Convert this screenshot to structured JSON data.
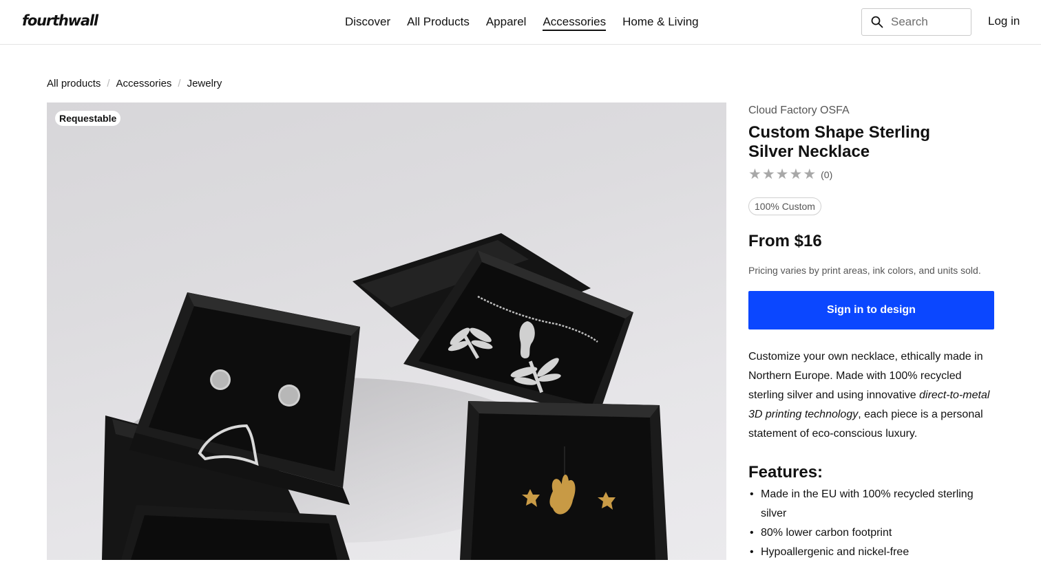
{
  "header": {
    "logo": "fourthwall",
    "nav": [
      "Discover",
      "All Products",
      "Apparel",
      "Accessories",
      "Home & Living"
    ],
    "active_nav": "Accessories",
    "search_placeholder": "Search",
    "login": "Log in"
  },
  "breadcrumb": [
    "All products",
    "Accessories",
    "Jewelry"
  ],
  "product": {
    "badge": "Requestable",
    "brand": "Cloud Factory OSFA",
    "title": "Custom Shape Sterling Silver Necklace",
    "rating": 0,
    "rating_count": "(0)",
    "tag": "100% Custom",
    "price": "From $16",
    "pricing_note": "Pricing varies by print areas, ink colors, and units sold.",
    "cta": "Sign in to design",
    "description": {
      "part1": "Customize your own necklace, ethically made in Northern Europe. Made with 100% recycled sterling silver and using innovative ",
      "emphasis": "direct-to-metal 3D printing technology",
      "part2": ", each piece is a personal statement of eco-conscious luxury."
    },
    "features_title": "Features:",
    "features": [
      "Made in the EU with 100% recycled sterling silver",
      "80% lower carbon footprint",
      "Hypoallergenic and nickel-free"
    ]
  },
  "colors": {
    "accent": "#0b47ff",
    "star_empty": "#a8a8a8"
  }
}
